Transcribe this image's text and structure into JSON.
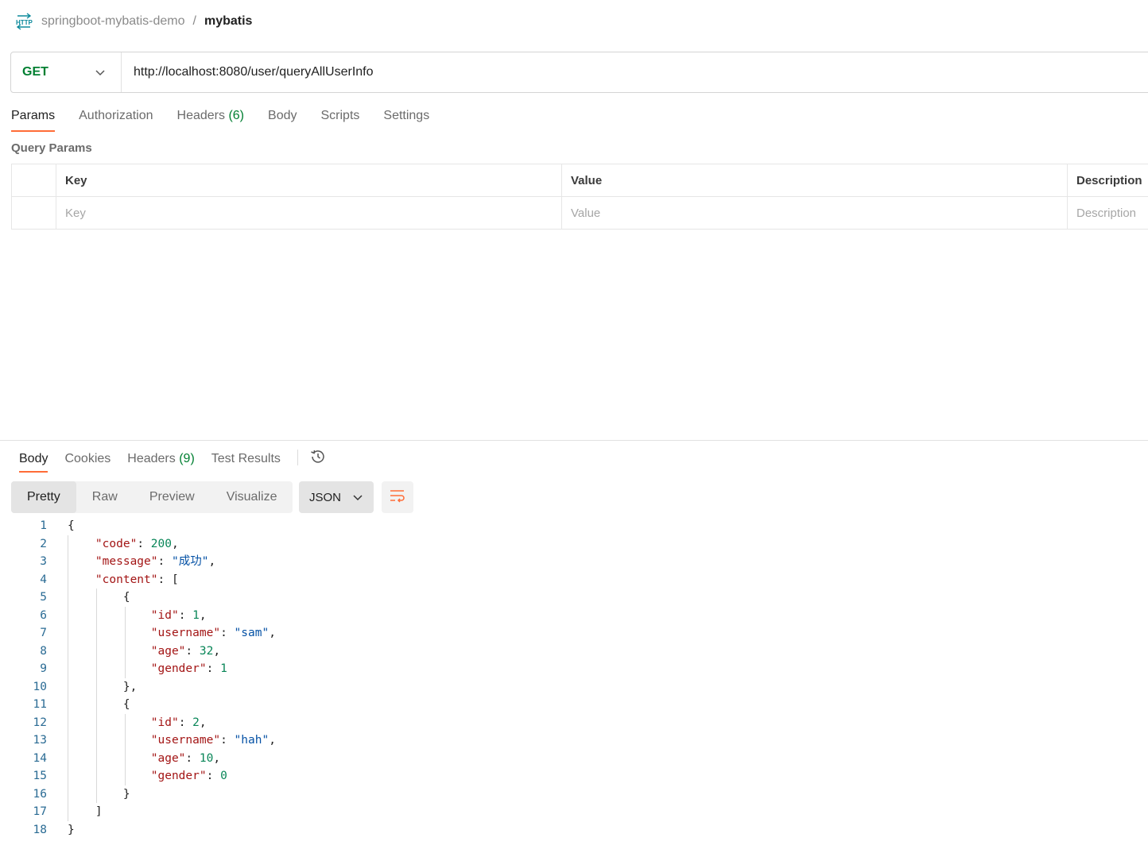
{
  "breadcrumb": {
    "icon": "http-icon",
    "parent": "springboot-mybatis-demo",
    "separator": "/",
    "current": "mybatis"
  },
  "request": {
    "method": "GET",
    "url": "http://localhost:8080/user/queryAllUserInfo"
  },
  "request_tabs": [
    {
      "label": "Params",
      "active": true
    },
    {
      "label": "Authorization"
    },
    {
      "label": "Headers",
      "count": "(6)"
    },
    {
      "label": "Body"
    },
    {
      "label": "Scripts"
    },
    {
      "label": "Settings"
    }
  ],
  "query_params": {
    "title": "Query Params",
    "headers": {
      "key": "Key",
      "value": "Value",
      "description": "Description"
    },
    "placeholders": {
      "key": "Key",
      "value": "Value",
      "description": "Description"
    }
  },
  "response_tabs": [
    {
      "label": "Body",
      "active": true
    },
    {
      "label": "Cookies"
    },
    {
      "label": "Headers",
      "count": "(9)"
    },
    {
      "label": "Test Results"
    }
  ],
  "view_modes": [
    "Pretty",
    "Raw",
    "Preview",
    "Visualize"
  ],
  "active_view": "Pretty",
  "format": "JSON",
  "colors": {
    "accent": "#ff6c37",
    "method_get": "#007f31",
    "json_key": "#a31515",
    "json_string": "#0451a5",
    "json_number": "#098658",
    "line_number": "#2a6b94"
  },
  "response_lines": [
    "{",
    "    \"code\": 200,",
    "    \"message\": \"成功\",",
    "    \"content\": [",
    "        {",
    "            \"id\": 1,",
    "            \"username\": \"sam\",",
    "            \"age\": 32,",
    "            \"gender\": 1",
    "        },",
    "        {",
    "            \"id\": 2,",
    "            \"username\": \"hah\",",
    "            \"age\": 10,",
    "            \"gender\": 0",
    "        }",
    "    ]",
    "}"
  ]
}
